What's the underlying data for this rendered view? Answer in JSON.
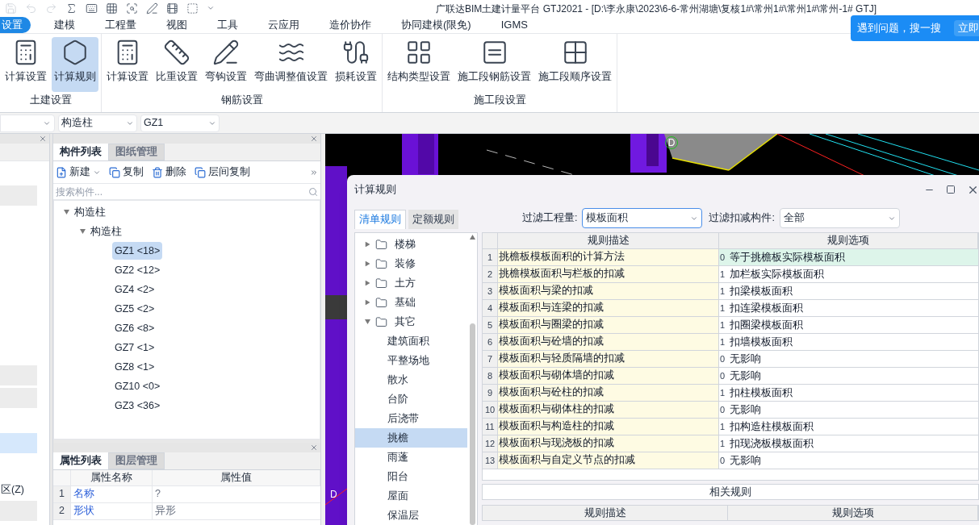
{
  "window": {
    "title": "广联达BIM土建计量平台 GTJ2021 - [D:\\李永康\\2023\\6-6-常州湖塘\\复核1#\\常州1#\\常州1#\\常州-1# GTJ]"
  },
  "help_popup": {
    "text": "遇到问题，搜一搜",
    "button": "立即"
  },
  "menu": [
    {
      "label": "设置",
      "selected": true
    },
    {
      "label": "建模",
      "selected": false
    },
    {
      "label": "工程量",
      "selected": false
    },
    {
      "label": "视图",
      "selected": false
    },
    {
      "label": "工具",
      "selected": false
    },
    {
      "label": "云应用",
      "selected": false
    },
    {
      "label": "造价协作",
      "selected": false
    },
    {
      "label": "协同建模(限免)",
      "selected": false
    },
    {
      "label": "IGMS",
      "selected": false
    }
  ],
  "ribbon": [
    {
      "name": "土建设置",
      "items": [
        {
          "label": "计算设置",
          "selected": false
        },
        {
          "label": "计算规则",
          "selected": true
        }
      ]
    },
    {
      "name": "钢筋设置",
      "items": [
        {
          "label": "计算设置",
          "selected": false
        },
        {
          "label": "比重设置",
          "selected": false
        },
        {
          "label": "弯钩设置",
          "selected": false
        },
        {
          "label": "弯曲调整值设置",
          "selected": false
        },
        {
          "label": "损耗设置",
          "selected": false
        }
      ]
    },
    {
      "name": "施工段设置",
      "items": [
        {
          "label": "结构类型设置",
          "selected": false
        },
        {
          "label": "施工段钢筋设置",
          "selected": false
        },
        {
          "label": "施工段顺序设置",
          "selected": false
        }
      ]
    }
  ],
  "selectors": [
    {
      "value": "构造柱"
    },
    {
      "value": "GZ1"
    }
  ],
  "left_panel": {
    "label": "区(Z)"
  },
  "component_panel": {
    "tabs": [
      {
        "label": "构件列表",
        "selected": true
      },
      {
        "label": "图纸管理",
        "selected": false
      }
    ],
    "toolbar": [
      "新建",
      "复制",
      "删除",
      "层间复制"
    ],
    "search": {
      "placeholder": "搜索构件..."
    },
    "tree": [
      {
        "label": "构造柱",
        "expanded": true,
        "children": [
          {
            "label": "构造柱",
            "expanded": true,
            "children": [
              {
                "label": "GZ1 <18>",
                "selected": true
              },
              {
                "label": "GZ2 <12>",
                "selected": false
              },
              {
                "label": "GZ4 <2>",
                "selected": false
              },
              {
                "label": "GZ5 <2>",
                "selected": false
              },
              {
                "label": "GZ6 <8>",
                "selected": false
              },
              {
                "label": "GZ7 <1>",
                "selected": false
              },
              {
                "label": "GZ8 <1>",
                "selected": false
              },
              {
                "label": "GZ10 <0>",
                "selected": false
              },
              {
                "label": "GZ3 <36>",
                "selected": false
              }
            ]
          }
        ]
      }
    ]
  },
  "property_panel": {
    "tabs": [
      {
        "label": "属性列表",
        "selected": true
      },
      {
        "label": "图层管理",
        "selected": false
      }
    ],
    "columns": [
      "属性名称",
      "属性值"
    ],
    "rows": [
      {
        "index": "1",
        "name": "名称",
        "value": "?"
      },
      {
        "index": "2",
        "name": "形状",
        "value": "异形"
      }
    ]
  },
  "viewport": {
    "axis_labels": [
      "D",
      "D"
    ]
  },
  "dialog": {
    "title": "计算规则",
    "tabs": [
      {
        "label": "清单规则",
        "selected": true
      },
      {
        "label": "定额规则",
        "selected": false
      }
    ],
    "filters": [
      {
        "label": "过滤工程量:",
        "value": "模板面积",
        "focused": true
      },
      {
        "label": "过滤扣减构件:",
        "value": "全部",
        "focused": false
      }
    ],
    "tree": [
      {
        "label": "楼梯",
        "expanded": false
      },
      {
        "label": "装修",
        "expanded": false
      },
      {
        "label": "土方",
        "expanded": false
      },
      {
        "label": "基础",
        "expanded": false
      },
      {
        "label": "其它",
        "expanded": true,
        "children": [
          {
            "label": "建筑面积",
            "selected": false
          },
          {
            "label": "平整场地",
            "selected": false
          },
          {
            "label": "散水",
            "selected": false
          },
          {
            "label": "台阶",
            "selected": false
          },
          {
            "label": "后浇带",
            "selected": false
          },
          {
            "label": "挑檐",
            "selected": true
          },
          {
            "label": "雨蓬",
            "selected": false
          },
          {
            "label": "阳台",
            "selected": false
          },
          {
            "label": "屋面",
            "selected": false
          },
          {
            "label": "保温层",
            "selected": false
          }
        ]
      }
    ],
    "columns": [
      "规则描述",
      "规则选项"
    ],
    "rows": [
      {
        "index": "1",
        "description": "挑檐板模板面积的计算方法",
        "option_code": "0",
        "option": "等于挑檐板实际模板面积",
        "selected": true
      },
      {
        "index": "2",
        "description": "挑檐模板面积与栏板的扣减",
        "option_code": "1",
        "option": "加栏板实际模板面积",
        "selected": false
      },
      {
        "index": "3",
        "description": "模板面积与梁的扣减",
        "option_code": "1",
        "option": "扣梁模板面积",
        "selected": false
      },
      {
        "index": "4",
        "description": "模板面积与连梁的扣减",
        "option_code": "1",
        "option": "扣连梁模板面积",
        "selected": false
      },
      {
        "index": "5",
        "description": "模板面积与圈梁的扣减",
        "option_code": "1",
        "option": "扣圈梁模板面积",
        "selected": false
      },
      {
        "index": "6",
        "description": "模板面积与砼墙的扣减",
        "option_code": "1",
        "option": "扣墙模板面积",
        "selected": false
      },
      {
        "index": "7",
        "description": "模板面积与轻质隔墙的扣减",
        "option_code": "0",
        "option": "无影响",
        "selected": false
      },
      {
        "index": "8",
        "description": "模板面积与砌体墙的扣减",
        "option_code": "0",
        "option": "无影响",
        "selected": false
      },
      {
        "index": "9",
        "description": "模板面积与砼柱的扣减",
        "option_code": "1",
        "option": "扣柱模板面积",
        "selected": false
      },
      {
        "index": "10",
        "description": "模板面积与砌体柱的扣减",
        "option_code": "0",
        "option": "无影响",
        "selected": false
      },
      {
        "index": "11",
        "description": "模板面积与构造柱的扣减",
        "option_code": "1",
        "option": "扣构造柱模板面积",
        "selected": false
      },
      {
        "index": "12",
        "description": "模板面积与现浇板的扣减",
        "option_code": "1",
        "option": "扣现浇板模板面积",
        "selected": false
      },
      {
        "index": "13",
        "description": "模板面积与自定义节点的扣减",
        "option_code": "0",
        "option": "无影响",
        "selected": false
      }
    ],
    "related_button": "相关规则",
    "related_columns": [
      "规则描述",
      "规则选项"
    ]
  }
}
